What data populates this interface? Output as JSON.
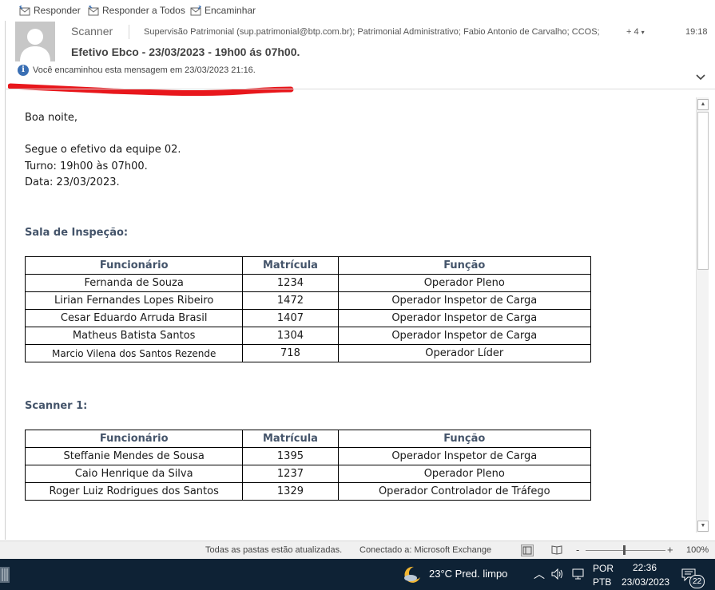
{
  "toolbar": {
    "reply": "Responder",
    "reply_all": "Responder a Todos",
    "forward": "Encaminhar"
  },
  "header": {
    "sender": "Scanner",
    "recipients": "Supervisão Patrimonial (sup.patrimonial@btp.com.br); Patrimonial Administrativo; Fabio Antonio de Carvalho; CCOS;",
    "more_recipients": "+ 4",
    "time": "19:18",
    "subject": "Efetivo Ebco - 23/03/2023 - 19h00 ás 07h00.",
    "info": "Você encaminhou esta mensagem em 23/03/2023 21:16.",
    "annotation_color": "#e8171c"
  },
  "body": {
    "greeting": "Boa noite,",
    "line1": "Segue o efetivo da equipe 02.",
    "line2": "Turno: 19h00 às 07h00.",
    "line3": "Data: 23/03/2023.",
    "section1_title": "Sala de Inspeção:",
    "section2_title": "Scanner 1:",
    "headers": [
      "Funcionário",
      "Matrícula",
      "Função"
    ],
    "table1": [
      [
        "Fernanda de Souza",
        "1234",
        "Operador Pleno"
      ],
      [
        "Lirian Fernandes Lopes Ribeiro",
        "1472",
        "Operador Inspetor de Carga"
      ],
      [
        "Cesar Eduardo Arruda Brasil",
        "1407",
        "Operador Inspetor de Carga"
      ],
      [
        "Matheus Batista Santos",
        "1304",
        "Operador Inspetor de Carga"
      ],
      [
        "Marcio Vilena dos Santos Rezende",
        "718",
        "Operador Líder"
      ]
    ],
    "table2": [
      [
        "Steffanie Mendes de Sousa",
        "1395",
        "Operador Inspetor de Carga"
      ],
      [
        "Caio Henrique da Silva",
        "1237",
        "Operador Pleno"
      ],
      [
        "Roger Luiz Rodrigues dos Santos",
        "1329",
        "Operador Controlador de Tráfego"
      ]
    ]
  },
  "status": {
    "folders": "Todas as pastas estão atualizadas.",
    "connection": "Conectado a: Microsoft Exchange",
    "zoom": "100%",
    "zoom_minus": "-",
    "zoom_plus": "+"
  },
  "taskbar": {
    "weather": "23°C  Pred. limpo",
    "lang1": "POR",
    "lang2": "PTB",
    "clock_time": "22:36",
    "clock_date": "23/03/2023",
    "notifications": "22"
  }
}
